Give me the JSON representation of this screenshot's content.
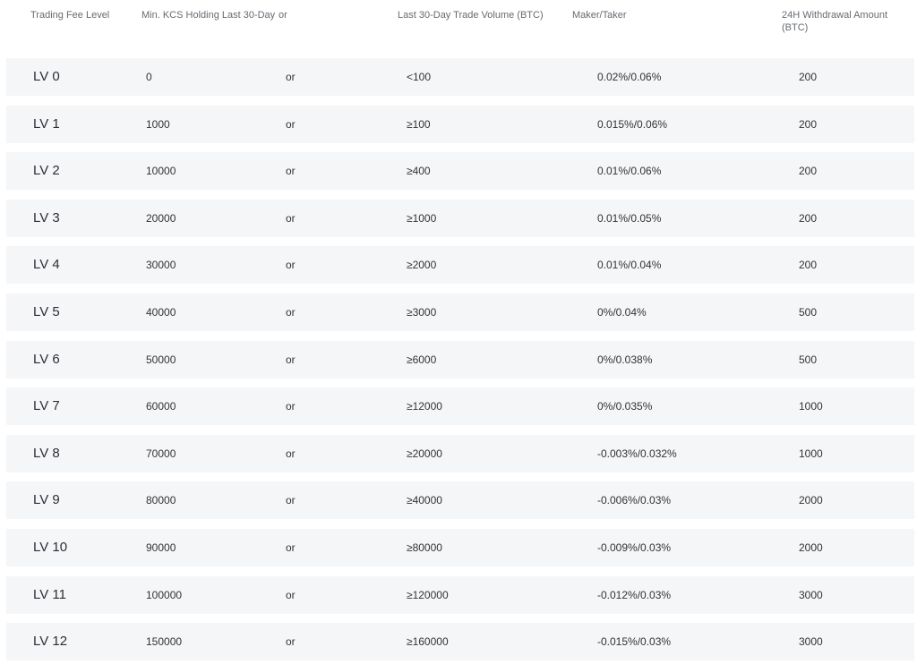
{
  "table": {
    "headers": {
      "level": "Trading Fee Level",
      "kcs": "Min. KCS Holding Last 30-Day",
      "or": "or",
      "volume": "Last 30-Day Trade Volume (BTC)",
      "maker_taker": "Maker/Taker",
      "withdrawal": "24H Withdrawal Amount (BTC)"
    },
    "rows": [
      {
        "level": "LV 0",
        "kcs": "0",
        "or": "or",
        "volume": "<100",
        "maker_taker": "0.02%/0.06%",
        "withdrawal": "200"
      },
      {
        "level": "LV 1",
        "kcs": "1000",
        "or": "or",
        "volume": "≥100",
        "maker_taker": "0.015%/0.06%",
        "withdrawal": "200"
      },
      {
        "level": "LV 2",
        "kcs": "10000",
        "or": "or",
        "volume": "≥400",
        "maker_taker": "0.01%/0.06%",
        "withdrawal": "200"
      },
      {
        "level": "LV 3",
        "kcs": "20000",
        "or": "or",
        "volume": "≥1000",
        "maker_taker": "0.01%/0.05%",
        "withdrawal": "200"
      },
      {
        "level": "LV 4",
        "kcs": "30000",
        "or": "or",
        "volume": "≥2000",
        "maker_taker": "0.01%/0.04%",
        "withdrawal": "200"
      },
      {
        "level": "LV 5",
        "kcs": "40000",
        "or": "or",
        "volume": "≥3000",
        "maker_taker": "0%/0.04%",
        "withdrawal": "500"
      },
      {
        "level": "LV 6",
        "kcs": "50000",
        "or": "or",
        "volume": "≥6000",
        "maker_taker": "0%/0.038%",
        "withdrawal": "500"
      },
      {
        "level": "LV 7",
        "kcs": "60000",
        "or": "or",
        "volume": "≥12000",
        "maker_taker": "0%/0.035%",
        "withdrawal": "1000"
      },
      {
        "level": "LV 8",
        "kcs": "70000",
        "or": "or",
        "volume": "≥20000",
        "maker_taker": "-0.003%/0.032%",
        "withdrawal": "1000"
      },
      {
        "level": "LV 9",
        "kcs": "80000",
        "or": "or",
        "volume": "≥40000",
        "maker_taker": "-0.006%/0.03%",
        "withdrawal": "2000"
      },
      {
        "level": "LV 10",
        "kcs": "90000",
        "or": "or",
        "volume": "≥80000",
        "maker_taker": "-0.009%/0.03%",
        "withdrawal": "2000"
      },
      {
        "level": "LV 11",
        "kcs": "100000",
        "or": "or",
        "volume": "≥120000",
        "maker_taker": "-0.012%/0.03%",
        "withdrawal": "3000"
      },
      {
        "level": "LV 12",
        "kcs": "150000",
        "or": "or",
        "volume": "≥160000",
        "maker_taker": "-0.015%/0.03%",
        "withdrawal": "3000"
      }
    ]
  }
}
